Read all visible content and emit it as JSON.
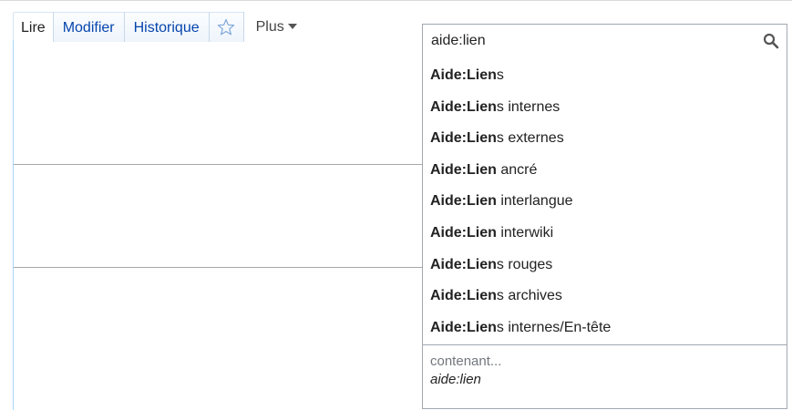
{
  "tabs": [
    {
      "label": "Lire",
      "selected": true
    },
    {
      "label": "Modifier",
      "selected": false
    },
    {
      "label": "Historique",
      "selected": false
    }
  ],
  "watch_icon": "star-outline-icon",
  "more_menu": {
    "label": "Plus",
    "icon": "chevron-down-icon"
  },
  "search": {
    "value": "aide:lien",
    "icon": "magnifier-icon"
  },
  "suggestions": [
    {
      "match": "Aide:Lien",
      "rest": "s"
    },
    {
      "match": "Aide:Lien",
      "rest": "s internes"
    },
    {
      "match": "Aide:Lien",
      "rest": "s externes"
    },
    {
      "match": "Aide:Lien",
      "rest": " ancré"
    },
    {
      "match": "Aide:Lien",
      "rest": " interlangue"
    },
    {
      "match": "Aide:Lien",
      "rest": " interwiki"
    },
    {
      "match": "Aide:Lien",
      "rest": "s rouges"
    },
    {
      "match": "Aide:Lien",
      "rest": "s archives"
    },
    {
      "match": "Aide:Lien",
      "rest": "s internes/En-tête"
    }
  ],
  "fulltext": {
    "label": "contenant...",
    "query": "aide:lien"
  },
  "colors": {
    "link": "#0645ad",
    "tab_border": "#a7d7f9",
    "input_border": "#a2a9b1"
  }
}
